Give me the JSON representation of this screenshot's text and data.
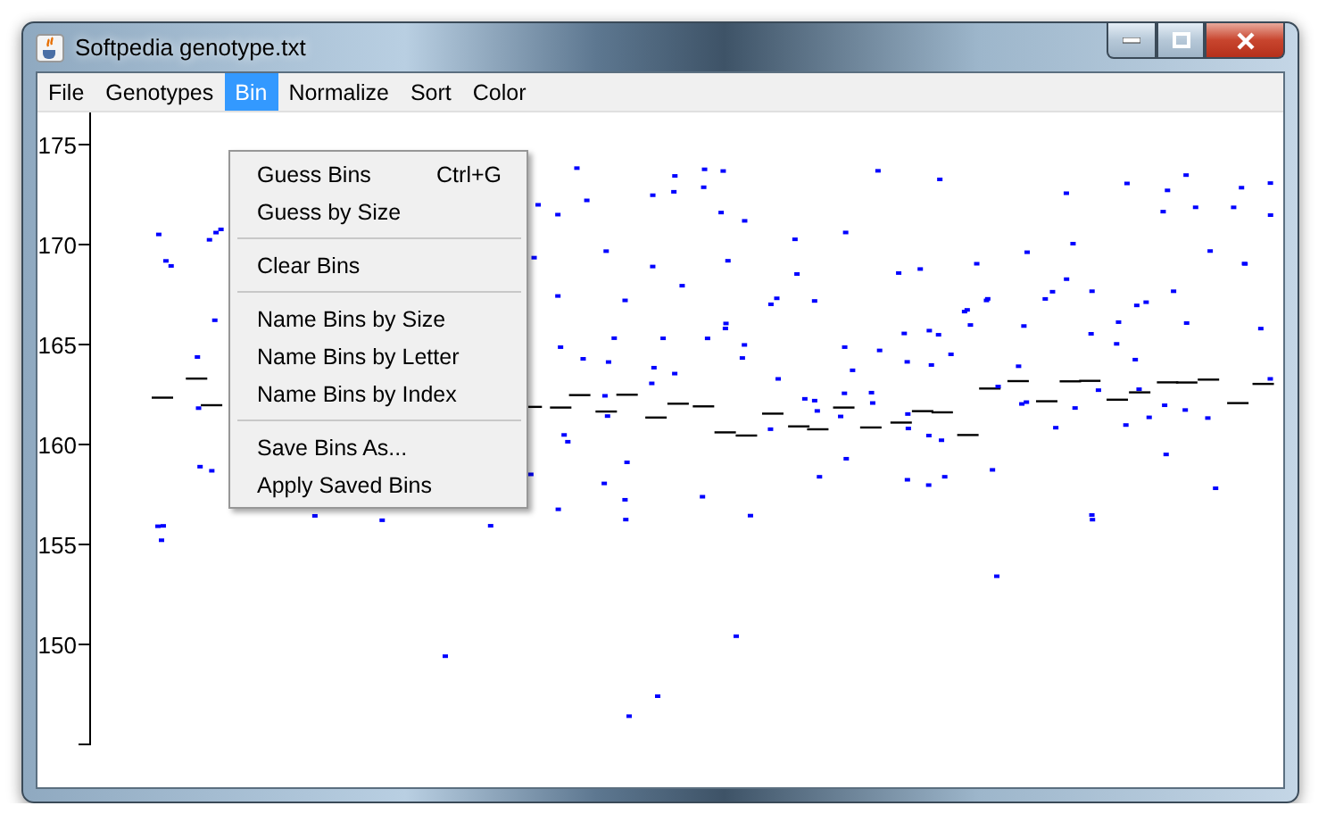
{
  "window": {
    "title": "Softpedia genotype.txt"
  },
  "menu_bar": [
    {
      "label": "File",
      "selected": false
    },
    {
      "label": "Genotypes",
      "selected": false
    },
    {
      "label": "Bin",
      "selected": true
    },
    {
      "label": "Normalize",
      "selected": false
    },
    {
      "label": "Sort",
      "selected": false
    },
    {
      "label": "Color",
      "selected": false
    }
  ],
  "dropdown": [
    {
      "kind": "item",
      "label": "Guess Bins",
      "shortcut": "Ctrl+G"
    },
    {
      "kind": "item",
      "label": "Guess by Size"
    },
    {
      "kind": "separator"
    },
    {
      "kind": "item",
      "label": "Clear Bins"
    },
    {
      "kind": "separator"
    },
    {
      "kind": "item",
      "label": "Name Bins by Size"
    },
    {
      "kind": "item",
      "label": "Name Bins by Letter"
    },
    {
      "kind": "item",
      "label": "Name Bins by Index"
    },
    {
      "kind": "separator"
    },
    {
      "kind": "item",
      "label": "Save Bins As..."
    },
    {
      "kind": "item",
      "label": "Apply Saved Bins"
    }
  ],
  "y_axis": {
    "ticks": [
      "175",
      "170",
      "165",
      "160",
      "155",
      "150"
    ]
  }
}
